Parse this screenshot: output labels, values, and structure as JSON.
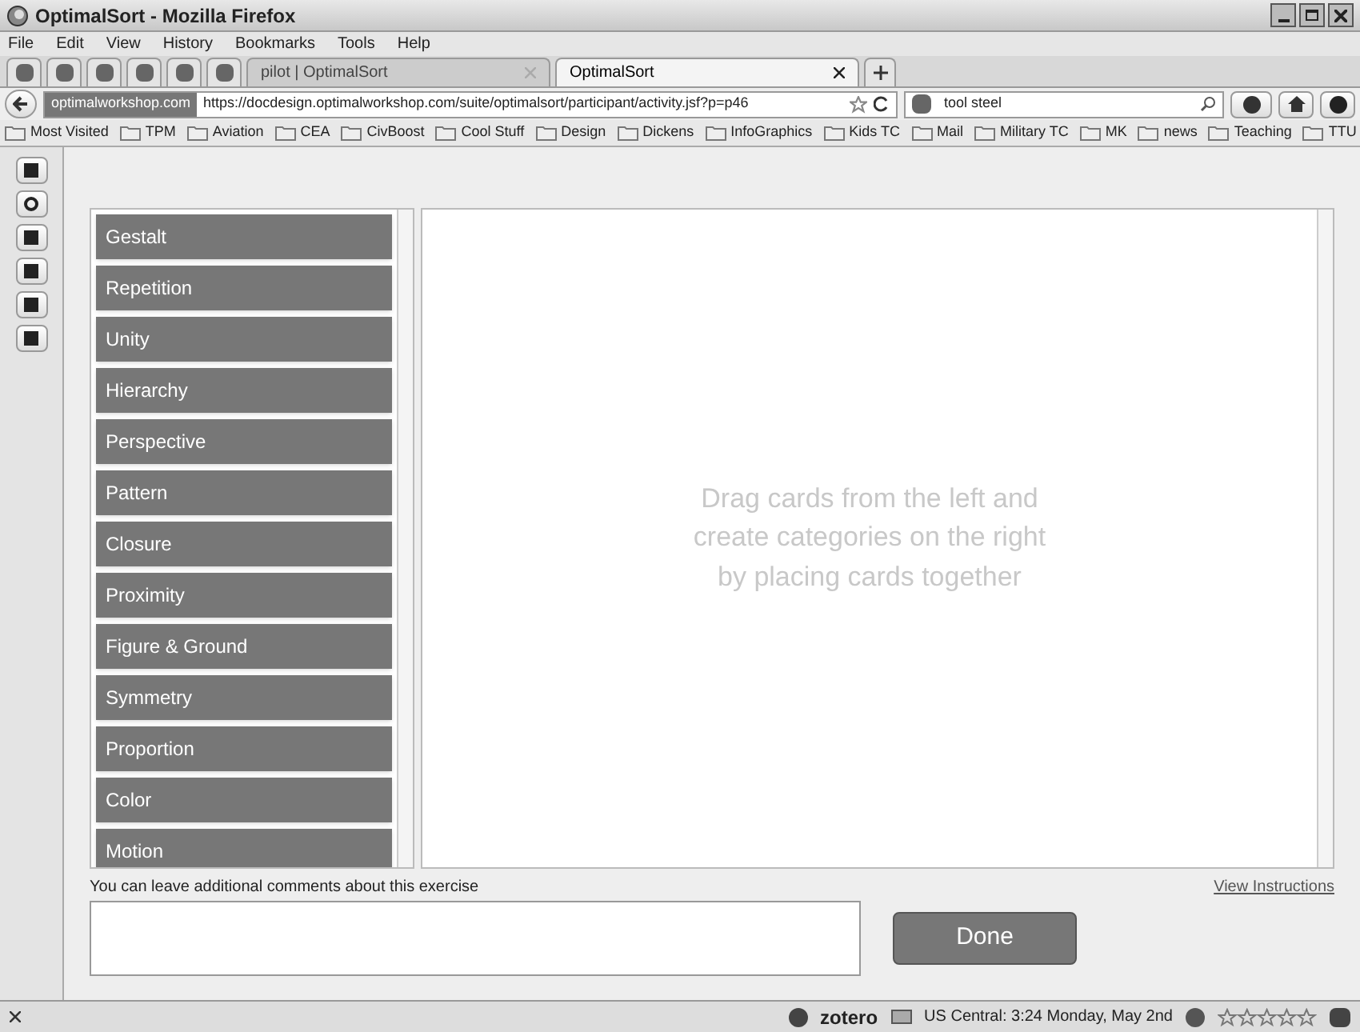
{
  "window": {
    "title": "OptimalSort - Mozilla Firefox"
  },
  "menu": [
    "File",
    "Edit",
    "View",
    "History",
    "Bookmarks",
    "Tools",
    "Help"
  ],
  "tabs": [
    {
      "label": "pilot | OptimalSort",
      "selected": false
    },
    {
      "label": "OptimalSort",
      "selected": true
    }
  ],
  "address": {
    "site": "optimalworkshop.com",
    "url": "https://docdesign.optimalworkshop.com/suite/optimalsort/participant/activity.jsf?p=p46"
  },
  "search": {
    "value": "tool steel"
  },
  "bookmarks": [
    "Most Visited",
    "TPM",
    "Aviation",
    "CEA",
    "CivBoost",
    "Cool Stuff",
    "Design",
    "Dickens",
    "InfoGraphics",
    "Kids TC",
    "Mail",
    "Military TC",
    "MK",
    "news",
    "Teaching",
    "TTU"
  ],
  "cards": [
    "Gestalt",
    "Repetition",
    "Unity",
    "Hierarchy",
    "Perspective",
    "Pattern",
    "Closure",
    "Proximity",
    "Figure & Ground",
    "Symmetry",
    "Proportion",
    "Color",
    "Motion"
  ],
  "canvas_hint": "Drag cards from the left and create categories on the right by placing cards together",
  "comments": {
    "label": "You can leave additional comments about this exercise",
    "link": "View Instructions"
  },
  "done_button": "Done",
  "status_bar": {
    "addon": "zotero",
    "clock": "US Central: 3:24 Monday, May 2nd"
  }
}
